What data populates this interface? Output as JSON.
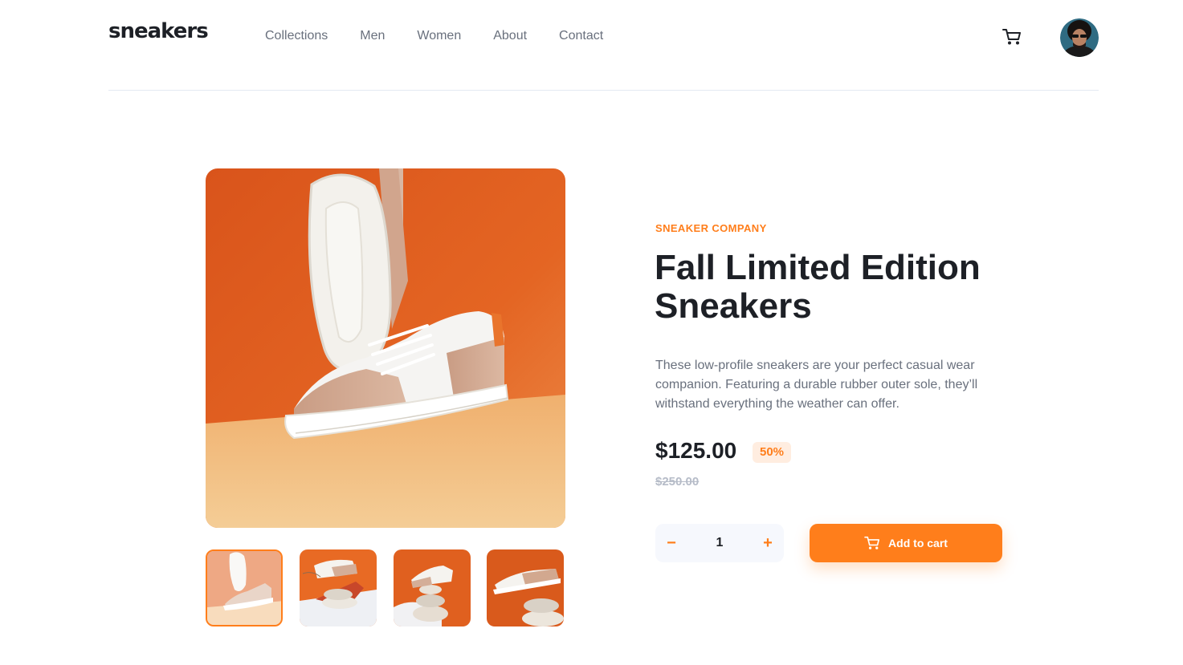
{
  "header": {
    "logo": "sneakers",
    "nav": [
      "Collections",
      "Men",
      "Women",
      "About",
      "Contact"
    ],
    "cart_icon": "cart-icon",
    "avatar_icon": "user-avatar"
  },
  "gallery": {
    "main_image": "sneaker-main-photo",
    "thumbnails": [
      {
        "name": "thumbnail-1",
        "active": true
      },
      {
        "name": "thumbnail-2",
        "active": false
      },
      {
        "name": "thumbnail-3",
        "active": false
      },
      {
        "name": "thumbnail-4",
        "active": false
      }
    ]
  },
  "product": {
    "company": "SNEAKER COMPANY",
    "title": "Fall Limited Edition Sneakers",
    "description": "These low-profile sneakers are your perfect casual wear companion. Featuring a durable rubber outer sole, they’ll withstand everything the weather can offer.",
    "price": "$125.00",
    "discount": "50%",
    "original_price": "$250.00",
    "quantity": "1",
    "minus_label": "−",
    "plus_label": "+",
    "add_to_cart": "Add to cart"
  },
  "colors": {
    "accent": "#ff7e1b",
    "accent_pale": "#ffede0",
    "text_dark": "#1d2026",
    "text_gray": "#69707d"
  }
}
